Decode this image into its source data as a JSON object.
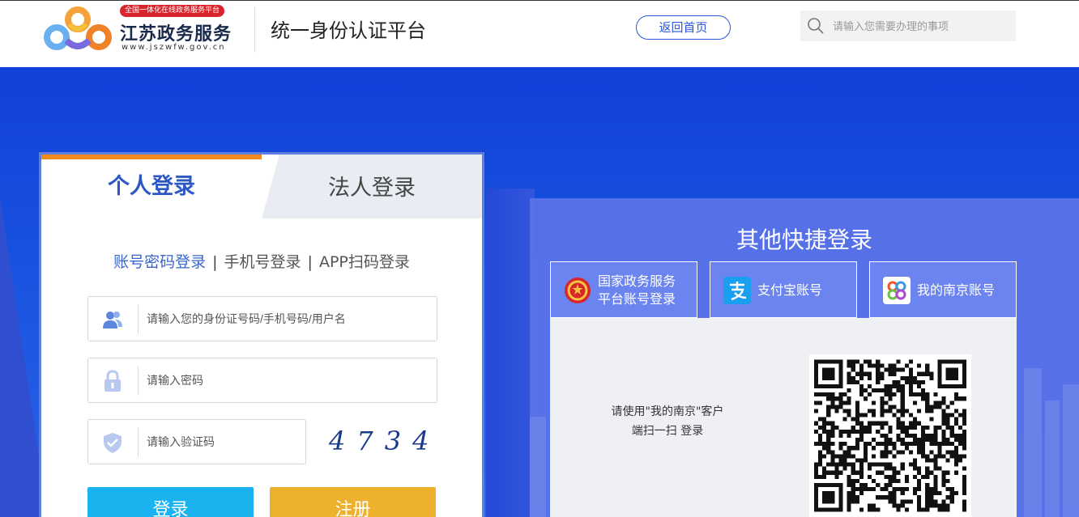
{
  "header": {
    "logo_tag": "全国一体化在线政务服务平台",
    "logo_name": "江苏政务服务",
    "logo_url": "www.jszwfw.gov.cn",
    "platform_title": "统一身份认证平台",
    "back_home": "返回首页",
    "search_placeholder": "请输入您需要办理的事项"
  },
  "login": {
    "tabs": [
      {
        "label": "个人登录",
        "active": true
      },
      {
        "label": "法人登录",
        "active": false
      }
    ],
    "modes": [
      {
        "label": "账号密码登录",
        "active": true
      },
      {
        "label": "手机号登录",
        "active": false
      },
      {
        "label": "APP扫码登录",
        "active": false
      }
    ],
    "mode_separator": "|",
    "user_placeholder": "请输入您的身份证号码/手机号码/用户名",
    "password_placeholder": "请输入密码",
    "code_placeholder": "请输入验证码",
    "captcha": "4734",
    "login_button": "登录",
    "register_button": "注册"
  },
  "quick": {
    "title": "其他快捷登录",
    "options": [
      {
        "label": "国家政务服务\n平台账号登录",
        "icon": "national-emblem-icon"
      },
      {
        "label": "支付宝账号",
        "icon": "alipay-icon"
      },
      {
        "label": "我的南京账号",
        "icon": "my-nanjing-icon"
      }
    ],
    "qr_hint_line1": "请使用\"我的南京\"客户",
    "qr_hint_line2": "端扫一扫 登录"
  },
  "colors": {
    "brand_blue": "#1a4fd4",
    "accent_orange": "#f08a1c",
    "login_button": "#1ab3f0",
    "register_button": "#eeb12d",
    "logo_tag_red": "#d9232d"
  }
}
